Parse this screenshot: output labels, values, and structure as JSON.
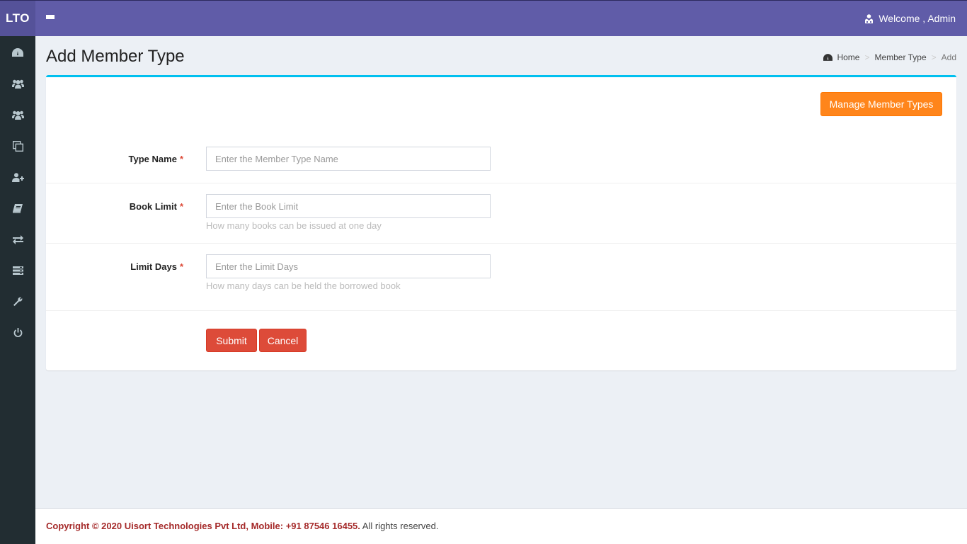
{
  "header": {
    "logo": "LTO",
    "menu_toggle_icon": "hamburger-icon",
    "user_icon": "user-tie-icon",
    "welcome_text": "Welcome , Admin"
  },
  "sidebar": {
    "items": [
      {
        "icon": "dashboard-icon"
      },
      {
        "icon": "users-icon"
      },
      {
        "icon": "users-group-icon"
      },
      {
        "icon": "copy-icon"
      },
      {
        "icon": "user-plus-icon"
      },
      {
        "icon": "book-icon"
      },
      {
        "icon": "exchange-icon"
      },
      {
        "icon": "list-icon"
      },
      {
        "icon": "wrench-icon"
      },
      {
        "icon": "power-icon"
      }
    ]
  },
  "page": {
    "title": "Add Member Type",
    "breadcrumb": [
      {
        "label": "Home",
        "icon": "dashboard-icon"
      },
      {
        "label": "Member Type"
      },
      {
        "label": "Add"
      }
    ]
  },
  "box": {
    "manage_button": "Manage Member Types"
  },
  "form": {
    "type_name": {
      "label": "Type Name",
      "required_marker": "*",
      "value": "",
      "placeholder": "Enter the Member Type Name"
    },
    "book_limit": {
      "label": "Book Limit",
      "required_marker": "*",
      "value": "",
      "placeholder": "Enter the Book Limit",
      "help": "How many books can be issued at one day"
    },
    "limit_days": {
      "label": "Limit Days",
      "required_marker": "*",
      "value": "",
      "placeholder": "Enter the Limit Days",
      "help": "How many days can be held the borrowed book"
    },
    "submit_label": "Submit",
    "cancel_label": "Cancel"
  },
  "footer": {
    "copyright": "Copyright © 2020 Uisort Technologies Pvt Ltd, Mobile: +91 87546 16455.",
    "rights": " All rights reserved."
  },
  "colors": {
    "header": "#605ca8",
    "sidebar": "#222d32",
    "box_accent": "#00c0ef",
    "manage_button": "#ff851b",
    "danger_button": "#dd4b39",
    "footer_brand": "#a52a2a"
  }
}
